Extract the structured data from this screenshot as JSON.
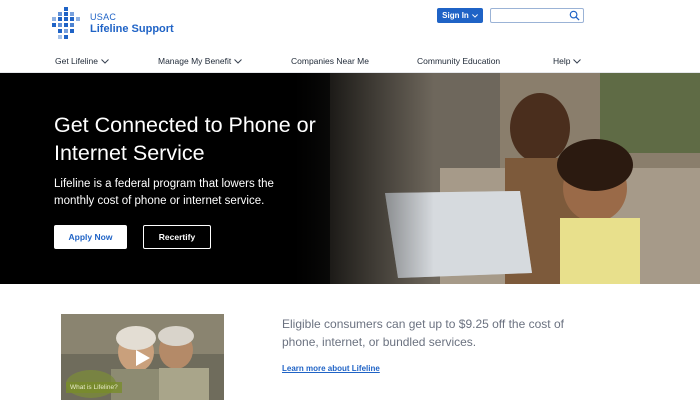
{
  "header": {
    "logo": {
      "org": "USAC",
      "name": "Lifeline Support"
    },
    "signin_label": "Sign In",
    "search": {
      "placeholder": "",
      "value": ""
    }
  },
  "nav": {
    "items": [
      {
        "label": "Get Lifeline",
        "has_dropdown": true
      },
      {
        "label": "Manage My Benefit",
        "has_dropdown": true
      },
      {
        "label": "Companies Near Me",
        "has_dropdown": false
      },
      {
        "label": "Community Education",
        "has_dropdown": false
      },
      {
        "label": "Help",
        "has_dropdown": true
      }
    ]
  },
  "hero": {
    "title": "Get Connected to Phone or Internet Service",
    "text": "Lifeline is a federal program that lowers the monthly cost of phone or internet service.",
    "apply_label": "Apply Now",
    "recertify_label": "Recertify"
  },
  "promo": {
    "video_caption": "What is Lifeline?",
    "text": "Eligible consumers can get up to $9.25 off the cost of phone, internet, or bundled services.",
    "link_label": "Learn more about Lifeline"
  },
  "colors": {
    "brand_blue": "#1f63c6",
    "hero_dark": "#000000"
  },
  "icons": [
    "usac-logo-mark",
    "chevron-down-icon",
    "search-icon",
    "play-icon"
  ]
}
